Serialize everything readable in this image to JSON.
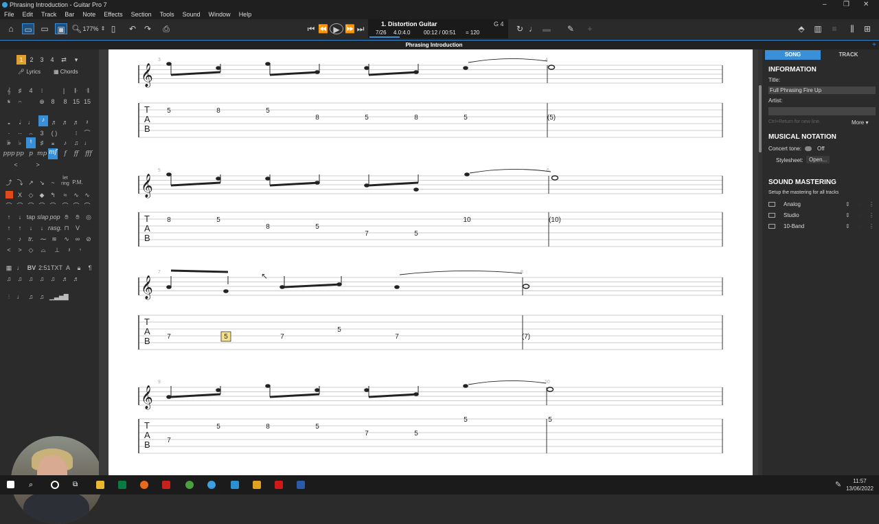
{
  "window": {
    "title": "Phrasing Introduction - Guitar Pro 7"
  },
  "menu": [
    "File",
    "Edit",
    "Track",
    "Bar",
    "Note",
    "Effects",
    "Section",
    "Tools",
    "Sound",
    "Window",
    "Help"
  ],
  "toolbar": {
    "zoom": "177%"
  },
  "lcd": {
    "track_name": "1. Distortion Guitar",
    "bar": "7/26",
    "time_signature": "4.0:4.0",
    "time": "00:12 / 00:51",
    "tempo": "= 120",
    "key": "G 4"
  },
  "document_tab": "Phrasing Introduction",
  "left_panel": {
    "track_tabs": [
      "1",
      "2",
      "3",
      "4"
    ],
    "lyrics_label": "Lyrics",
    "chords_label": "Chords",
    "palette_text": {
      "bv": "BV",
      "tuplet": "2:51",
      "txt": "TXT",
      "dyn_ppp": "ppp",
      "dyn_pp": "pp",
      "dyn_p": "p",
      "dyn_mp": "mp",
      "dyn_mf": "mf",
      "dyn_f": "f",
      "dyn_ff": "ff",
      "dyn_fff": "fff",
      "let_ring": "let ring",
      "pm": "P.M.",
      "tap": "tap",
      "slap": "slap",
      "pop": "pop",
      "rasg": "rasg.",
      "trill": "tr."
    }
  },
  "score": {
    "systems": [
      {
        "start_bar": "3",
        "end_bar": "4",
        "tab_numbers": [
          "5",
          "8",
          "5",
          "8",
          "5",
          "8",
          "5",
          "(5)"
        ]
      },
      {
        "start_bar": "5",
        "end_bar": "6",
        "tab_numbers": [
          "8",
          "5",
          "8",
          "5",
          "7",
          "5",
          "10",
          "(10)"
        ]
      },
      {
        "start_bar": "7",
        "end_bar": "8",
        "tab_numbers": [
          "7",
          "5",
          "7",
          "5",
          "7",
          "(7)"
        ]
      },
      {
        "start_bar": "9",
        "end_bar": "10",
        "tab_numbers": [
          "7",
          "5",
          "8",
          "5",
          "7",
          "5",
          "5",
          "5"
        ]
      }
    ],
    "tab_letters": [
      "T",
      "A",
      "B"
    ]
  },
  "right_panel": {
    "tabs": [
      "SONG",
      "TRACK"
    ],
    "information_heading": "INFORMATION",
    "title_label": "Title:",
    "title_value": "Full Phrasing Fire Up",
    "artist_label": "Artist:",
    "hint": "Ctrl+Return for new line.",
    "more_label": "More",
    "notation_heading": "MUSICAL NOTATION",
    "concert_tone_label": "Concert tone:",
    "concert_tone_value": "Off",
    "stylesheet_label": "Stylesheet:",
    "stylesheet_button": "Open...",
    "mastering_heading": "SOUND MASTERING",
    "mastering_desc": "Setup the mastering for all tracks",
    "mastering_items": [
      "Analog",
      "Studio",
      "10-Band"
    ]
  },
  "taskbar": {
    "time": "11:57",
    "date": "13/06/2022"
  },
  "colors": {
    "accent": "#3a8fd9",
    "selected_fret_bg": "#f5e08a",
    "orange_tab": "#e0a030"
  }
}
